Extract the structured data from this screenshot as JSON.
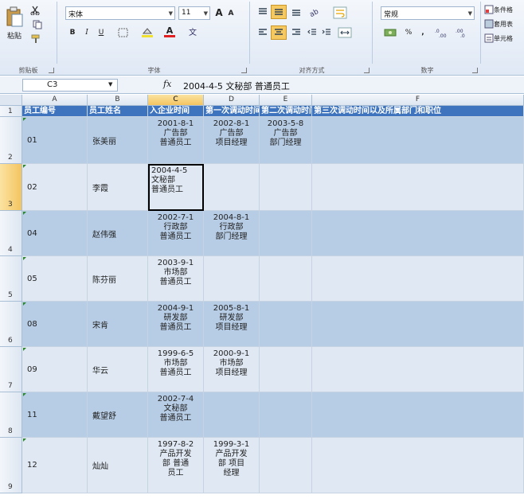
{
  "ribbon": {
    "clipboard": {
      "paste_label": "粘贴",
      "group_label": "剪贴板"
    },
    "font": {
      "name": "宋体",
      "size": "11",
      "grow": "A",
      "shrink": "A",
      "bold": "B",
      "italic": "I",
      "underline": "U",
      "font_color_letter": "A",
      "group_label": "字体"
    },
    "alignment": {
      "group_label": "对齐方式"
    },
    "number": {
      "format": "常规",
      "percent": "%",
      "comma": ",",
      "group_label": "数字"
    },
    "styles": {
      "item1": "条件格",
      "item2": "套用表",
      "item3": "单元格"
    }
  },
  "formula_bar": {
    "name_box": "C3",
    "fx": "fx",
    "content": "2004-4-5  文秘部  普通员工"
  },
  "columns": [
    "A",
    "B",
    "C",
    "D",
    "E",
    "F"
  ],
  "headers": [
    "员工编号",
    "员工姓名",
    "入企业时间",
    "第一次调动时间",
    "第二次调动时间",
    "第三次调动时间以及所属部门和职位"
  ],
  "rows": [
    {
      "num": "2",
      "id": "01",
      "name": "张美丽",
      "c": "2001-8-1\n广告部\n普通员工",
      "d": "2002-8-1\n广告部\n项目经理",
      "e": "2003-5-8\n广告部\n部门经理"
    },
    {
      "num": "3",
      "id": "02",
      "name": "李霞",
      "c": "2004-4-5\n文秘部\n普通员工",
      "d": "",
      "e": ""
    },
    {
      "num": "4",
      "id": "04",
      "name": "赵伟强",
      "c": "2002-7-1\n行政部\n普通员工",
      "d": "2004-8-1\n行政部\n部门经理",
      "e": ""
    },
    {
      "num": "5",
      "id": "05",
      "name": "陈芬丽",
      "c": "2003-9-1\n市场部\n普通员工",
      "d": "",
      "e": ""
    },
    {
      "num": "6",
      "id": "08",
      "name": "宋肯",
      "c": "2004-9-1\n研发部\n普通员工",
      "d": "2005-8-1\n研发部\n项目经理",
      "e": ""
    },
    {
      "num": "7",
      "id": "09",
      "name": "华云",
      "c": "1999-6-5\n市场部\n普通员工",
      "d": "2000-9-1\n市场部\n项目经理",
      "e": ""
    },
    {
      "num": "8",
      "id": "11",
      "name": "戴望舒",
      "c": "2002-7-4\n文秘部\n普通员工",
      "d": "",
      "e": ""
    },
    {
      "num": "9",
      "id": "12",
      "name": "灿灿",
      "c": "1997-8-2\n产品开发\n部  普通\n员工",
      "d": "1999-3-1\n产品开发\n部  项目\n经理",
      "e": ""
    }
  ],
  "header_row_num": "1",
  "colors": {
    "header_bg": "#3e74bd",
    "band_dark": "#b7cde6",
    "band_light": "#dfe8f3"
  }
}
